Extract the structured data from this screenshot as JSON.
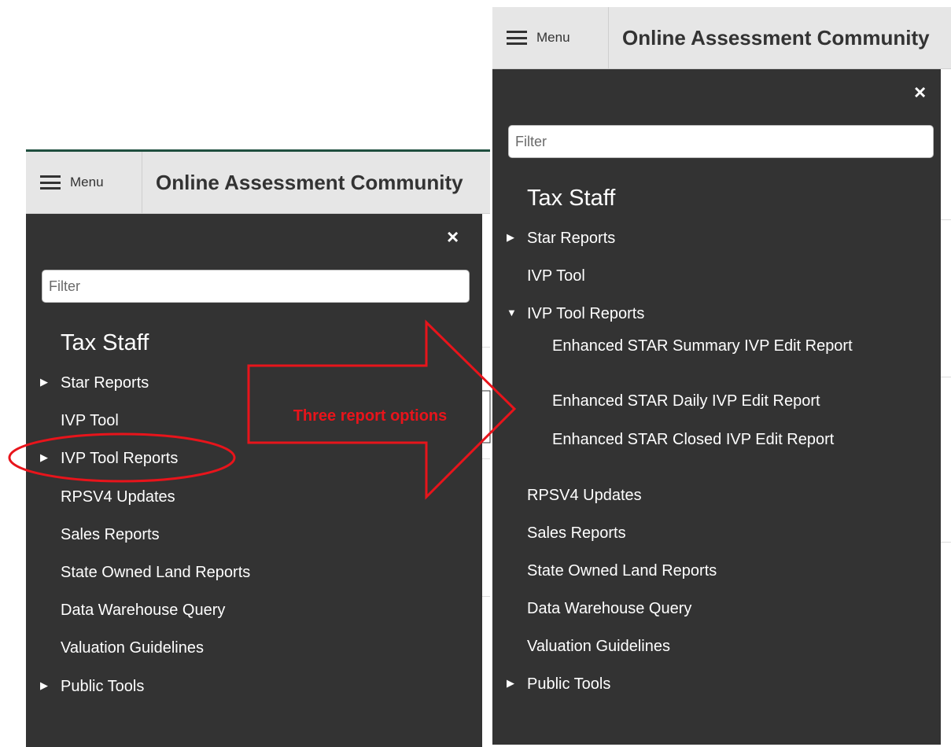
{
  "left_screenshot": {
    "menu_label": "Menu",
    "app_title": "Online Assessment Community",
    "close_symbol": "×",
    "filter_placeholder": "Filter",
    "section_title": "Tax Staff",
    "nav_items": [
      {
        "label": "Star Reports",
        "has_caret": true,
        "expanded": false
      },
      {
        "label": "IVP Tool",
        "has_caret": false
      },
      {
        "label": "IVP Tool Reports",
        "has_caret": true,
        "expanded": false
      },
      {
        "label": "RPSV4 Updates",
        "has_caret": false
      },
      {
        "label": "Sales Reports",
        "has_caret": false
      },
      {
        "label": "State Owned Land Reports",
        "has_caret": false
      },
      {
        "label": "Data Warehouse Query",
        "has_caret": false
      },
      {
        "label": "Valuation Guidelines",
        "has_caret": false
      },
      {
        "label": "Public Tools",
        "has_caret": true,
        "expanded": false
      }
    ]
  },
  "right_screenshot": {
    "menu_label": "Menu",
    "app_title": "Online Assessment Community",
    "close_symbol": "×",
    "filter_placeholder": "Filter",
    "section_title": "Tax Staff",
    "nav_items": [
      {
        "label": "Star Reports",
        "has_caret": true,
        "expanded": false
      },
      {
        "label": "IVP Tool",
        "has_caret": false
      },
      {
        "label": "IVP Tool Reports",
        "has_caret": true,
        "expanded": true
      },
      {
        "label": "RPSV4 Updates",
        "has_caret": false
      },
      {
        "label": "Sales Reports",
        "has_caret": false
      },
      {
        "label": "State Owned Land Reports",
        "has_caret": false
      },
      {
        "label": "Data Warehouse Query",
        "has_caret": false
      },
      {
        "label": "Valuation Guidelines",
        "has_caret": false
      },
      {
        "label": "Public Tools",
        "has_caret": true,
        "expanded": false
      }
    ],
    "sub_items": [
      "Enhanced STAR Summary IVP Edit Report",
      "Enhanced STAR Daily IVP Edit Report",
      "Enhanced STAR Closed IVP Edit Report"
    ]
  },
  "annotation": {
    "callout_text": "Three report options",
    "highlight_color": "#e8141b"
  },
  "icons": {
    "caret_collapsed": "▶",
    "caret_expanded": "▼"
  }
}
